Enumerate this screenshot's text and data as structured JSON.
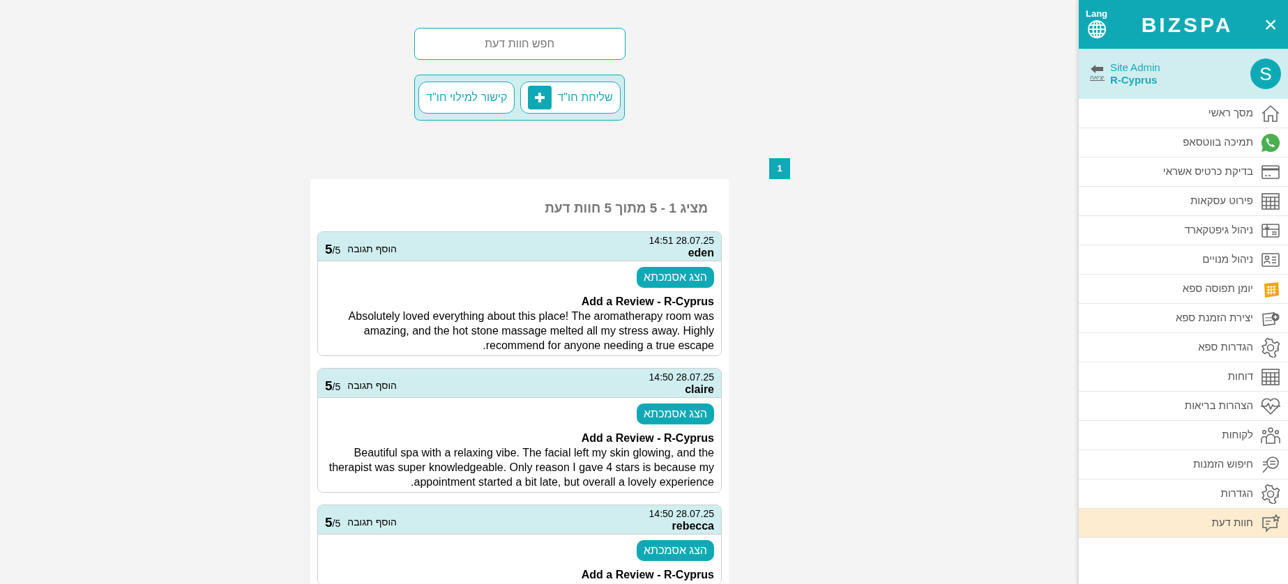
{
  "search": {
    "placeholder": "חפש חוות דעת"
  },
  "actions": [
    {
      "label": "שליחת חו\"ד",
      "kind": "add"
    },
    {
      "label": "קישור למילוי חו\"ד",
      "kind": "link"
    }
  ],
  "pagination": [
    {
      "label": "1",
      "selected": true
    }
  ],
  "summary": "מציג 1 - 5 מתוך 5 חוות דעת",
  "reviews": [
    {
      "datetime": "14:51 28.07.25",
      "name": "eden",
      "reply_link": "הוסף תגובה",
      "score": "**5**/5",
      "proof_button": "הצג אסמכתא",
      "title": "Add a Review - R-Cyprus",
      "text": "Absolutely loved everything about this place! The aromatherapy room was amazing, and the hot stone massage melted all my stress away. Highly recommend for anyone needing a true escape."
    },
    {
      "datetime": "14:50 28.07.25",
      "name": "claire",
      "reply_link": "הוסף תגובה",
      "score": "**5**/5",
      "proof_button": "הצג אסמכתא",
      "title": "Add a Review - R-Cyprus",
      "text": "Beautiful spa with a relaxing vibe. The facial left my skin glowing, and the therapist was super knowledgeable. Only reason I gave 4 stars is because my appointment started a bit late, but overall a lovely experience."
    },
    {
      "datetime": "14:50 28.07.25",
      "name": "rebecca",
      "reply_link": "הוסף תגובה",
      "score": "**5**/5",
      "proof_button": "הצג אסמכתא",
      "title": "Add a Review - R-Cyprus"
    }
  ],
  "sidebar": {
    "lang_label": "Lang",
    "logo": "BIZSPA",
    "close": "×",
    "user": {
      "avatar": "S",
      "role": "Site Admin",
      "site": "R-Cyprus",
      "logout": "יציאה"
    },
    "items": [
      {
        "label": "מסך ראשי",
        "selected": false
      },
      {
        "label": "תמיכה בווטסאפ",
        "selected": false
      },
      {
        "label": "בדיקת כרטיס אשראי",
        "selected": false
      },
      {
        "label": "פירוט עסקאות",
        "selected": false
      },
      {
        "label": "ניהול גיפטקארד",
        "selected": false
      },
      {
        "label": "ניהול מנויים",
        "selected": false
      },
      {
        "label": "יומן תפוסה ספא",
        "selected": false
      },
      {
        "label": "יצירת הזמנת ספא",
        "selected": false
      },
      {
        "label": "הגדרות ספא",
        "selected": false
      },
      {
        "label": "דוחות",
        "selected": false
      },
      {
        "label": "הצהרות בריאות",
        "selected": false
      },
      {
        "label": "לקוחות",
        "selected": false
      },
      {
        "label": "חיפוש הזמנות",
        "selected": false
      },
      {
        "label": "הגדרות",
        "selected": false
      },
      {
        "label": "חוות דעת",
        "selected": true
      }
    ]
  }
}
